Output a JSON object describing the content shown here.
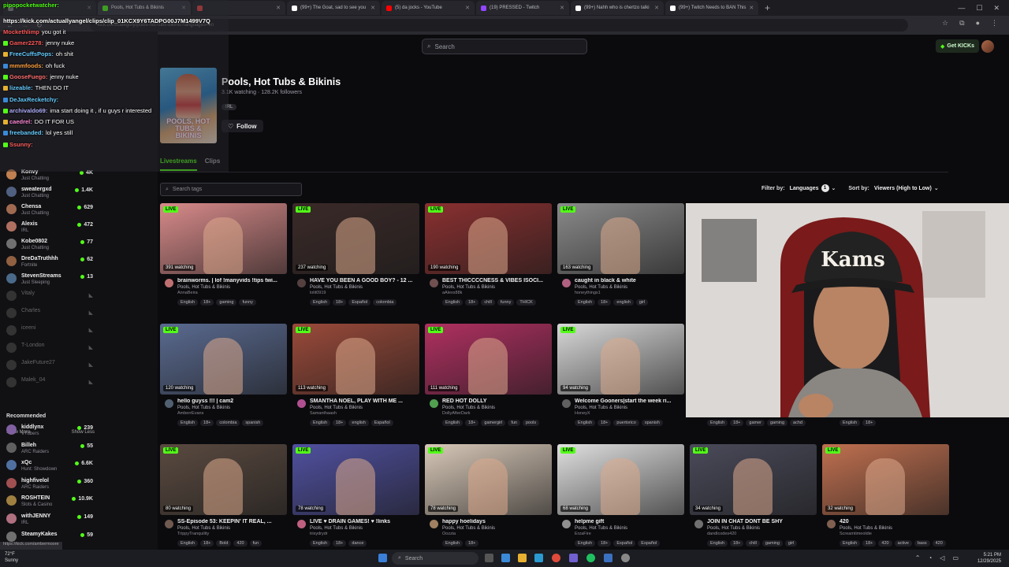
{
  "browser": {
    "tabs": [
      {
        "label": "",
        "active": false,
        "color": "#888888"
      },
      {
        "label": "Pools, Hot Tubs & Bikinis",
        "active": true,
        "color": "#53fc18"
      },
      {
        "label": "",
        "active": false,
        "color": "#e44444"
      },
      {
        "label": "(99+) The Goat, sad to see you",
        "active": false,
        "color": "#ffffff"
      },
      {
        "label": "(5) da jocks - YouTube",
        "active": false,
        "color": "#ff0000"
      },
      {
        "label": "(19) PRESSED - Twitch",
        "active": false,
        "color": "#9146ff"
      },
      {
        "label": "(99+) Nahh who is chertzo talki",
        "active": false,
        "color": "#ffffff"
      },
      {
        "label": "(99+) Twitch Needs to BAN This",
        "active": false,
        "color": "#ffffff"
      }
    ],
    "address": "kick.com/category/pools-hot-tubs-bikinis?languages=en"
  },
  "kick": {
    "search_placeholder": "Search",
    "get_kicks": "Get KICKs"
  },
  "chat": [
    {
      "user": "Gamer2278:",
      "msg": "jenny nuke",
      "color": "#ff5a5a"
    },
    {
      "user": "FreeCuffsPops:",
      "msg": "oh shit",
      "color": "#66ccff"
    },
    {
      "user": "mmmfoods:",
      "msg": "oh fuck",
      "color": "#ffa040"
    },
    {
      "user": "GooseFuego:",
      "msg": "jenny nuke",
      "color": "#ff7070"
    },
    {
      "user": "lizeable:",
      "msg": "THEN DO IT",
      "color": "#66ccff"
    },
    {
      "user": "DeJaxRecketchy:",
      "msg": "",
      "color": "#66ccff"
    },
    {
      "user": "archivaldo69:",
      "msg": "ima start doing it , if u guys r interested",
      "color": "#b0b0ff"
    },
    {
      "user": "caedrel:",
      "msg": "DO IT FOR US",
      "color": "#ff8ad8"
    },
    {
      "user": "freebanded:",
      "msg": "lol yes still",
      "color": "#66ccff"
    },
    {
      "user": "Ssunny:",
      "msg": "",
      "color": "#ff6060"
    }
  ],
  "chat_header": {
    "user": "pipopocketwatcher:",
    "url": "https://kick.com/actuallyangel/clips/clip_01KCX9Y6TADPG00J7M1499V7Q",
    "mod": "Mockethlimp",
    "mod_msg": "you got it"
  },
  "sidebar": {
    "following": [
      {
        "name": "Konvy",
        "cat": "Just Chatting",
        "viewers": "4K",
        "live": true,
        "color": "#c08050"
      },
      {
        "name": "sweatergxd",
        "cat": "Just Chatting",
        "viewers": "1.4K",
        "live": true,
        "color": "#506080"
      },
      {
        "name": "Chensa",
        "cat": "Just Chatting",
        "viewers": "629",
        "live": true,
        "color": "#a06a50"
      },
      {
        "name": "Alexis",
        "cat": "IRL",
        "viewers": "472",
        "live": true,
        "color": "#b07060"
      },
      {
        "name": "Kobe0802",
        "cat": "Just Chatting",
        "viewers": "77",
        "live": true,
        "color": "#707070"
      },
      {
        "name": "DreDaTruthhh",
        "cat": "Fortnite",
        "viewers": "62",
        "live": true,
        "color": "#906040"
      },
      {
        "name": "StevenStreams",
        "cat": "Just Sleeping",
        "viewers": "13",
        "live": true,
        "color": "#4a6a8a"
      },
      {
        "name": "Vitaly",
        "cat": "",
        "viewers": "",
        "live": false,
        "color": "#333"
      },
      {
        "name": "Charles",
        "cat": "",
        "viewers": "",
        "live": false,
        "color": "#333"
      },
      {
        "name": "iceeni",
        "cat": "",
        "viewers": "",
        "live": false,
        "color": "#333"
      },
      {
        "name": "T-London",
        "cat": "",
        "viewers": "",
        "live": false,
        "color": "#333"
      },
      {
        "name": "JakeFuture27",
        "cat": "",
        "viewers": "",
        "live": false,
        "color": "#333"
      },
      {
        "name": "Malek_04",
        "cat": "",
        "viewers": "",
        "live": false,
        "color": "#333"
      }
    ],
    "show_more": "Show More",
    "show_less": "Show Less",
    "recommended_label": "Recommended",
    "recommended": [
      {
        "name": "kiddlynx",
        "cat": "VTubers",
        "viewers": "239",
        "color": "#8060a0"
      },
      {
        "name": "Billeh",
        "cat": "ARC Raiders",
        "viewers": "55",
        "color": "#606060"
      },
      {
        "name": "xQc",
        "cat": "Hunt: Showdown",
        "viewers": "6.6K",
        "color": "#5070a0"
      },
      {
        "name": "highfivelol",
        "cat": "ARC Raiders",
        "viewers": "360",
        "color": "#a05050"
      },
      {
        "name": "ROSHTEIN",
        "cat": "Slots & Casino",
        "viewers": "10.9K",
        "color": "#a08040"
      },
      {
        "name": "withJENNY",
        "cat": "IRL",
        "viewers": "149",
        "color": "#b07080"
      },
      {
        "name": "SteamyKakes",
        "cat": "",
        "viewers": "59",
        "color": "#707070"
      }
    ]
  },
  "category": {
    "title": "Pools, Hot Tubs & Bikinis",
    "stats": "3.1K watching · 128.2K followers",
    "tag": "IRL",
    "follow": "Follow",
    "thumb_text": "POOLS, HOT TUBS & BIKINIS",
    "tab_livestreams": "Livestreams",
    "tab_clips": "Clips",
    "tag_search": "Search tags",
    "filter_label": "Filter by:",
    "languages": "Languages",
    "languages_count": "1",
    "sort_label": "Sort by:",
    "sort_value": "Viewers (High to Low)"
  },
  "streams": [
    {
      "title": "brainworms. | lof !manyvids !tips twi...",
      "cat": "Pools, Hot Tubs & Bikinis",
      "user": "AnnaBeira",
      "watching": "391 watching",
      "tags": [
        "English",
        "18+",
        "gaming",
        "funny"
      ],
      "bg": "#d88a8a",
      "av": "#c07070"
    },
    {
      "title": "HAVE YOU BEEN A GOOD BOY? - 12 ...",
      "cat": "Pools, Hot Tubs & Bikinis",
      "user": "lolit0919",
      "watching": "237 watching",
      "tags": [
        "English",
        "18+",
        "Español",
        "colombia"
      ],
      "bg": "#3a2a28",
      "av": "#554040"
    },
    {
      "title": "BEST THICCCCNESS & VIBES ISOCI...",
      "cat": "Pools, Hot Tubs & Bikinis",
      "user": "aAlexx88k",
      "watching": "190 watching",
      "tags": [
        "English",
        "18+",
        "chill",
        "funny",
        "THICK"
      ],
      "bg": "#8a3030",
      "av": "#705050"
    },
    {
      "title": "caught in black & white",
      "cat": "Pools, Hot Tubs & Bikinis",
      "user": "honeythings1",
      "watching": "163 watching",
      "tags": [
        "English",
        "18+",
        "english",
        "girl"
      ],
      "bg": "#8a8a8a",
      "av": "#b06080"
    },
    {
      "title": "hello guyss !!! | cam2",
      "cat": "Pools, Hot Tubs & Bikinis",
      "user": "AmberrEvans",
      "watching": "120 watching",
      "tags": [
        "English",
        "18+",
        "colombia",
        "spanish"
      ],
      "bg": "#5a6a90",
      "av": "#506070"
    },
    {
      "title": "SMANTHA NOEL, PLAY WITH ME ...",
      "cat": "Pools, Hot Tubs & Bikinis",
      "user": "Samanthaash",
      "watching": "113 watching",
      "tags": [
        "English",
        "18+",
        "english",
        "Español"
      ],
      "bg": "#9a4a3a",
      "av": "#b05090"
    },
    {
      "title": "RED HOT DOLLY",
      "cat": "Pools, Hot Tubs & Bikinis",
      "user": "DollyAfterDark",
      "watching": "111 watching",
      "tags": [
        "English",
        "18+",
        "gamergirl",
        "fun",
        "pools"
      ],
      "bg": "#b03060",
      "av": "#50a050"
    },
    {
      "title": "Welcome Gooners|start the week ri...",
      "cat": "Pools, Hot Tubs & Bikinis",
      "user": "HoneyX",
      "watching": "94 watching",
      "tags": [
        "English",
        "18+",
        "puertorico",
        "spanish"
      ],
      "bg": "#d8d8d8",
      "av": "#606060"
    },
    {
      "title": "",
      "cat": "",
      "user": "",
      "watching": "",
      "tags": [
        "English",
        "18+",
        "gamer",
        "gaming",
        "achd"
      ],
      "bg": "#000000",
      "av": "#000000"
    },
    {
      "title": "",
      "cat": "",
      "user": "",
      "watching": "",
      "tags": [
        "English",
        "18+"
      ],
      "bg": "#000000",
      "av": "#000000"
    },
    {
      "title": "SS-Episode 53: KEEPIN' IT REAL, ...",
      "cat": "Pools, Hot Tubs & Bikinis",
      "user": "TrippyTranquility",
      "watching": "80 watching",
      "tags": [
        "English",
        "18+",
        "Bold",
        "420",
        "fun"
      ],
      "bg": "#5a4a40",
      "av": "#705a50"
    },
    {
      "title": "LIVE ♥ DRAIN GAMES! ♥ !links",
      "cat": "Pools, Hot Tubs & Bikinis",
      "user": "trixydrydr",
      "watching": "78 watching",
      "tags": [
        "English",
        "18+",
        "dance"
      ],
      "bg": "#5050a0",
      "av": "#c06080"
    },
    {
      "title": "happy hoelidays",
      "cat": "Pools, Hot Tubs & Bikinis",
      "user": "Oozzia",
      "watching": "78 watching",
      "tags": [
        "English",
        "18+"
      ],
      "bg": "#d8c8b8",
      "av": "#a08060"
    },
    {
      "title": "helpme gift",
      "cat": "Pools, Hot Tubs & Bikinis",
      "user": "ErzaFire",
      "watching": "68 watching",
      "tags": [
        "English",
        "18+",
        "Español",
        "Español"
      ],
      "bg": "#e0e0e0",
      "av": "#909090"
    },
    {
      "title": "JOIN IN CHAT DONT BE SHY",
      "cat": "Pools, Hot Tubs & Bikinis",
      "user": "dandlcodes420",
      "watching": "34 watching",
      "tags": [
        "English",
        "18+",
        "chill",
        "gaming",
        "girl"
      ],
      "bg": "#4a4a5a",
      "av": "#707070"
    },
    {
      "title": "420",
      "cat": "Pools, Hot Tubs & Bikinis",
      "user": "Screamtimeoldie",
      "watching": "32 watching",
      "tags": [
        "English",
        "18+",
        "420",
        "active",
        "bass",
        "420"
      ],
      "bg": "#c07050",
      "av": "#806050"
    }
  ],
  "live_label": "LIVE",
  "taskbar": {
    "search": "Search",
    "temp": "72°F",
    "weather": "Sunny",
    "time": "5:21 PM",
    "date": "12/29/2025"
  },
  "status_url": "https://kick.com/ambermoore"
}
